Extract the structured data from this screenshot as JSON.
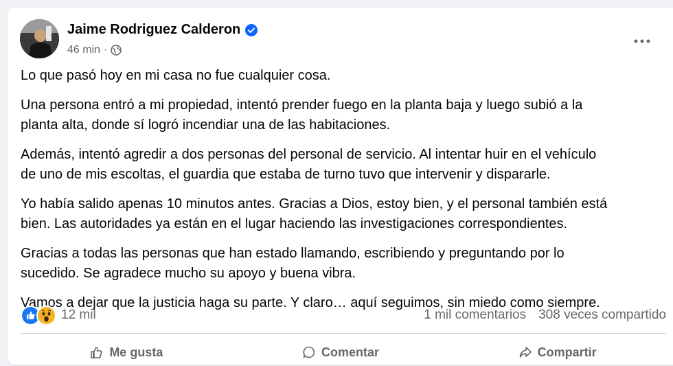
{
  "post": {
    "author": "Jaime Rodriguez Calderon",
    "time": "46 min",
    "separator": "·",
    "paragraphs": [
      "Lo que pasó hoy en mi casa no fue cualquier cosa.",
      "Una persona entró a mi propiedad, intentó prender fuego en la planta baja y luego subió a la",
      "planta alta, donde sí logró incendiar una de las habitaciones.",
      "Además, intentó agredir a dos personas del personal de servicio. Al intentar huir en el vehículo",
      "de uno de mis escoltas, el guardia que estaba de turno tuvo que intervenir y dispararle.",
      "Yo había salido apenas 10 minutos antes. Gracias a Dios, estoy bien, y el personal también está",
      "bien. Las autoridades ya están en el lugar haciendo las investigaciones correspondientes.",
      "Gracias a todas las personas que han estado llamando, escribiendo y preguntando por lo",
      "sucedido. Se agradece mucho su apoyo y buena vibra.",
      "Vamos a dejar que la justicia haga su parte. Y claro… aquí seguimos, sin miedo como siempre."
    ]
  },
  "stats": {
    "reactions_count": "12 mil",
    "comments": "1 mil comentarios",
    "shares": "308 veces compartido"
  },
  "actions": {
    "like": "Me gusta",
    "comment": "Comentar",
    "share": "Compartir"
  },
  "icons": {
    "verified": "verified-badge-icon",
    "audience": "globe-icon",
    "more": "more-options-icon",
    "reaction_like": "like-reaction-icon",
    "reaction_wow": "wow-reaction-icon"
  },
  "colors": {
    "verified_blue": "#0866ff",
    "secondary_text": "#65676b",
    "wow_yellow": "#f7b125"
  }
}
